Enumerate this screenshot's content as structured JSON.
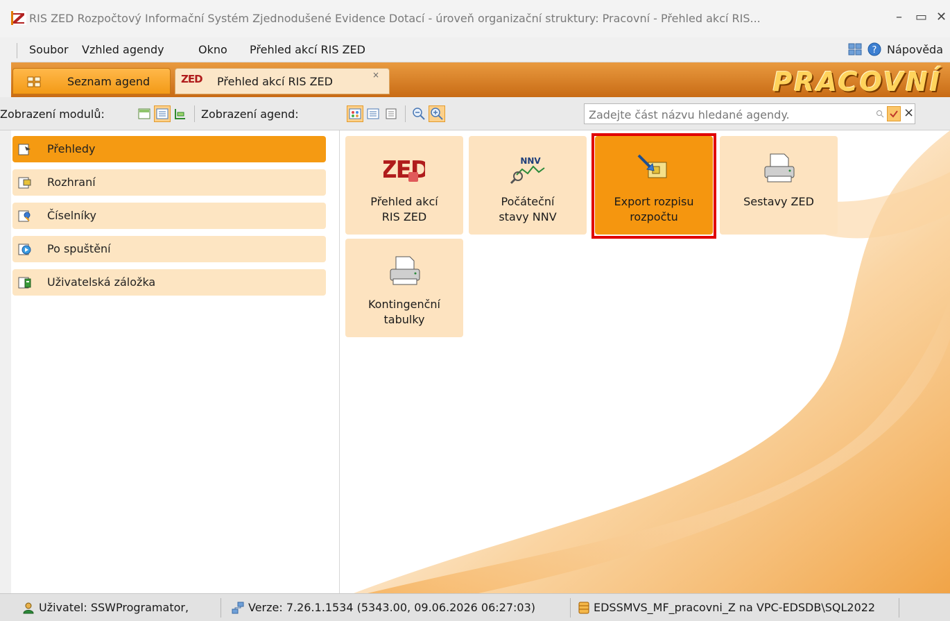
{
  "window": {
    "title": "RIS ZED Rozpočtový Informační Systém Zjednodušené Evidence Dotací - úroveň organizační struktury: Pracovní - Přehled akcí RIS...",
    "minimize": "–",
    "maximize": "▭",
    "close": "✕"
  },
  "menu": {
    "items": [
      "Soubor",
      "Vzhled agendy",
      "Okno",
      "Přehled akcí RIS ZED"
    ],
    "help": "Nápověda"
  },
  "tabs": {
    "agendas": "Seznam agend",
    "overview": "Přehled akcí RIS ZED",
    "close": "×",
    "overview_icon_text": "ZED",
    "brand": "PRACOVNÍ"
  },
  "toolbar": {
    "modules_label": "Zobrazení modulů:",
    "agendas_label": "Zobrazení agend:",
    "search_placeholder": "Zadejte část názvu hledané agendy.",
    "clear": "×"
  },
  "modules": [
    {
      "label": "Přehledy",
      "active": true
    },
    {
      "label": "Rozhraní",
      "active": false
    },
    {
      "label": "Číselníky",
      "active": false
    },
    {
      "label": "Po spuštění",
      "active": false
    },
    {
      "label": "Uživatelská záložka",
      "active": false
    }
  ],
  "tiles": [
    {
      "label": "Přehled akcí\nRIS ZED",
      "icon": "zed-logo-icon",
      "icon_text": "ZED"
    },
    {
      "label": "Počáteční\nstavy NNV",
      "icon": "nnv-chart-icon",
      "icon_text": "NNV"
    },
    {
      "label": "Export rozpisu\nrozpočtu",
      "icon": "export-arrow-icon",
      "active": true
    },
    {
      "label": "Sestavy ZED",
      "icon": "printer-icon"
    },
    {
      "label": "Kontingenční\ntabulky",
      "icon": "printer-icon"
    }
  ],
  "status": {
    "user": "Uživatel: SSWProgramator,",
    "version": "Verze: 7.26.1.1534 (5343.00, 09.06.2026 06:27:03)",
    "database": "EDSSMVS_MF_pracovni_Z na VPC-EDSDB\\SQL2022"
  },
  "colors": {
    "accent_orange": "#f5960f",
    "tile_light": "#fde3c0",
    "highlight_red": "#e00000"
  }
}
